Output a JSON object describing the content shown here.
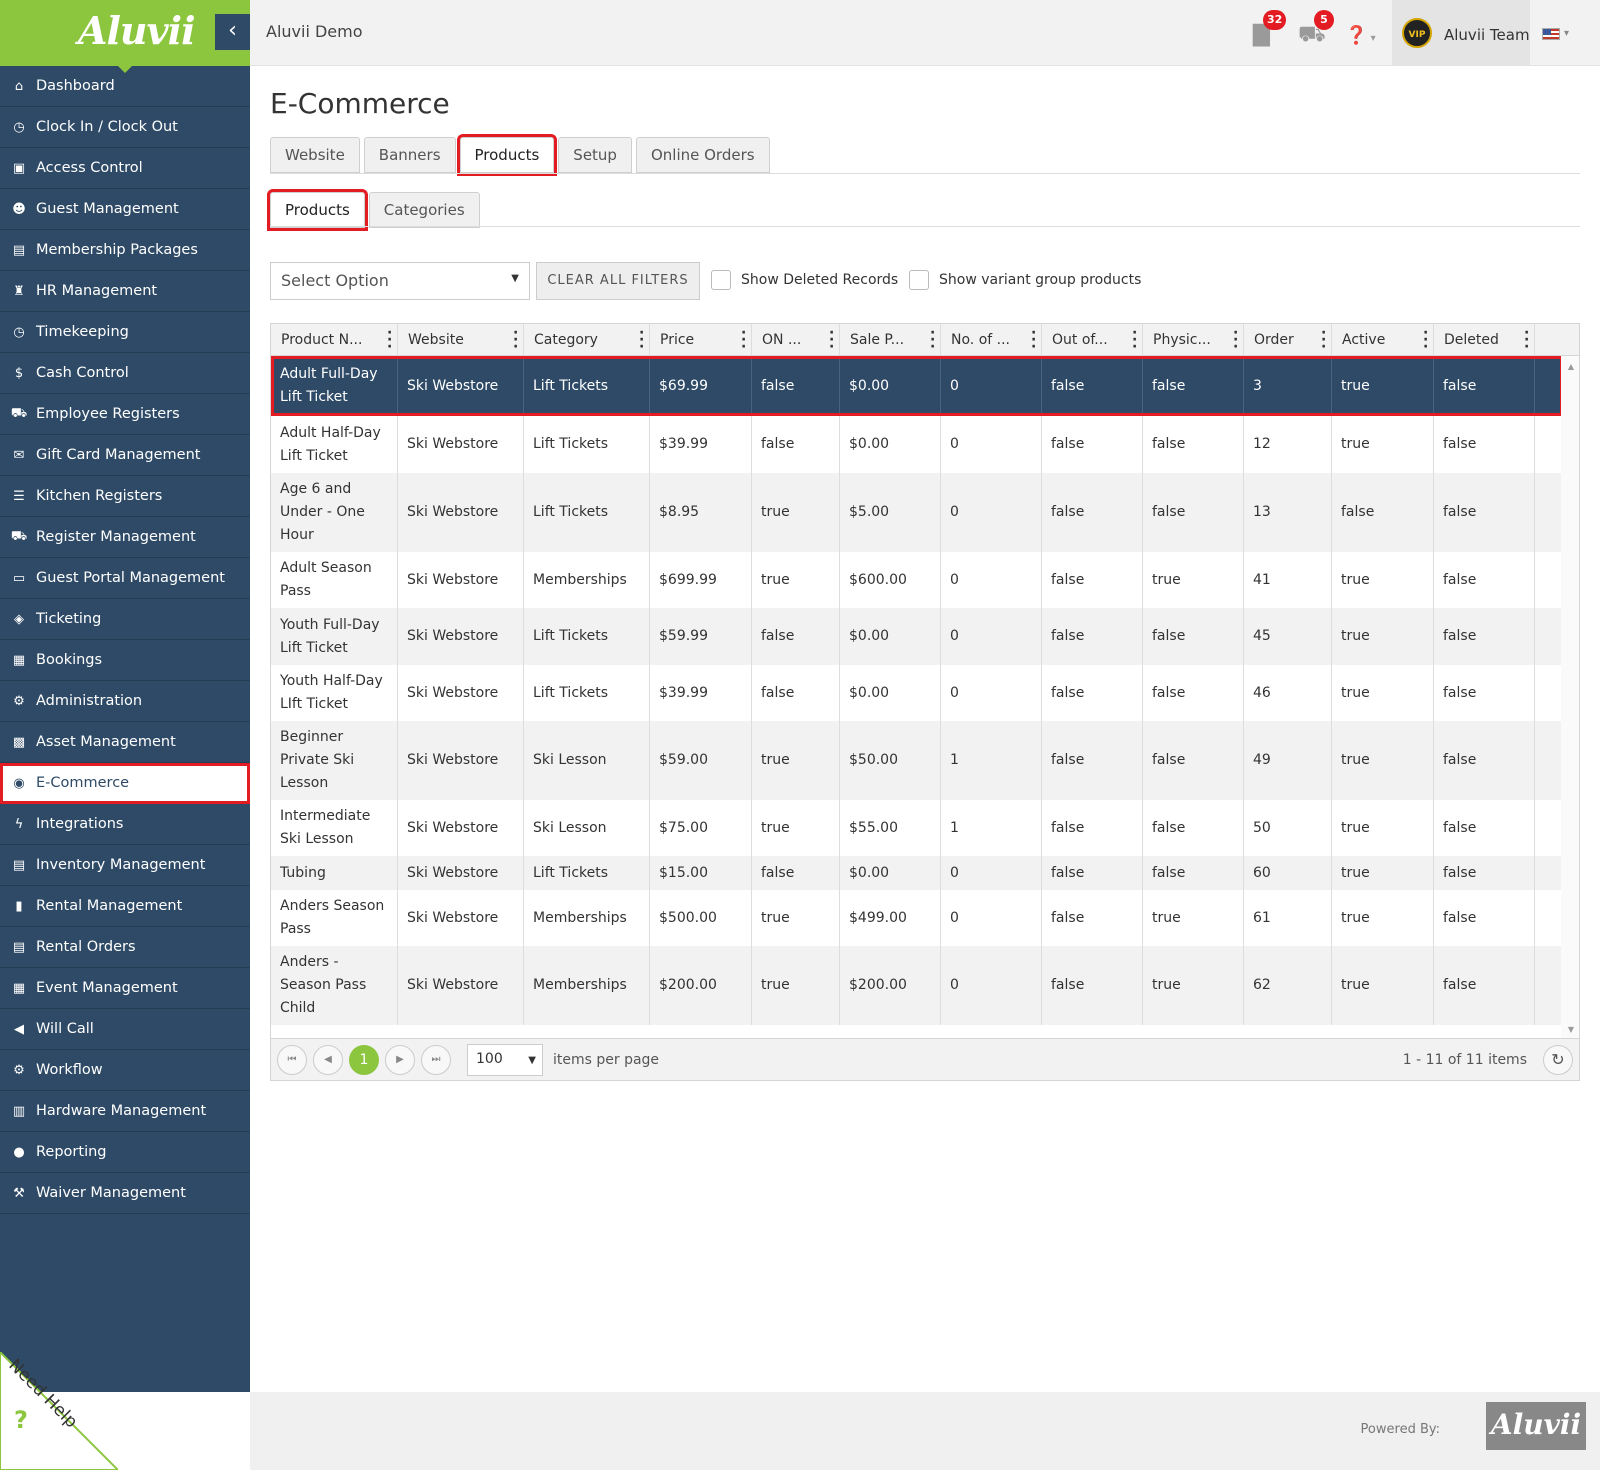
{
  "brand": {
    "logo_text": "Aluvii",
    "accent": "#8cc63f",
    "sidebar_bg": "#2e4a66",
    "highlight": "#e31b23"
  },
  "topbar": {
    "app_title": "Aluvii Demo",
    "notifications_badge": "32",
    "cart_badge": "5",
    "user_name": "Aluvii Team",
    "avatar_text": "VIP"
  },
  "sidebar": {
    "items": [
      {
        "label": "Dashboard",
        "icon": "home-icon",
        "glyph": "⌂"
      },
      {
        "label": "Clock In / Clock Out",
        "icon": "clock-icon",
        "glyph": "◷"
      },
      {
        "label": "Access Control",
        "icon": "lock-icon",
        "glyph": "▣"
      },
      {
        "label": "Guest Management",
        "icon": "users-icon",
        "glyph": "☻"
      },
      {
        "label": "Membership Packages",
        "icon": "card-icon",
        "glyph": "▤"
      },
      {
        "label": "HR Management",
        "icon": "hr-icon",
        "glyph": "♜"
      },
      {
        "label": "Timekeeping",
        "icon": "clock-icon",
        "glyph": "◷"
      },
      {
        "label": "Cash Control",
        "icon": "dollar-icon",
        "glyph": "$"
      },
      {
        "label": "Employee Registers",
        "icon": "cart-icon",
        "glyph": "⛟"
      },
      {
        "label": "Gift Card Management",
        "icon": "gift-icon",
        "glyph": "✉"
      },
      {
        "label": "Kitchen Registers",
        "icon": "list-icon",
        "glyph": "☰"
      },
      {
        "label": "Register Management",
        "icon": "cart-icon",
        "glyph": "⛟"
      },
      {
        "label": "Guest Portal Management",
        "icon": "laptop-icon",
        "glyph": "▭"
      },
      {
        "label": "Ticketing",
        "icon": "ticket-icon",
        "glyph": "◈"
      },
      {
        "label": "Bookings",
        "icon": "calendar-icon",
        "glyph": "▦"
      },
      {
        "label": "Administration",
        "icon": "cogs-icon",
        "glyph": "⚙"
      },
      {
        "label": "Asset Management",
        "icon": "cubes-icon",
        "glyph": "▩"
      },
      {
        "label": "E-Commerce",
        "icon": "globe-icon",
        "glyph": "◉"
      },
      {
        "label": "Integrations",
        "icon": "bolt-icon",
        "glyph": "ϟ"
      },
      {
        "label": "Inventory Management",
        "icon": "inventory-icon",
        "glyph": "▤"
      },
      {
        "label": "Rental Management",
        "icon": "clipboard-icon",
        "glyph": "▮"
      },
      {
        "label": "Rental Orders",
        "icon": "list-alt-icon",
        "glyph": "▤"
      },
      {
        "label": "Event Management",
        "icon": "calendar-check-icon",
        "glyph": "▦"
      },
      {
        "label": "Will Call",
        "icon": "bullhorn-icon",
        "glyph": "◀"
      },
      {
        "label": "Workflow",
        "icon": "gear-icon",
        "glyph": "⚙"
      },
      {
        "label": "Hardware Management",
        "icon": "print-icon",
        "glyph": "▥"
      },
      {
        "label": "Reporting",
        "icon": "lightbulb-icon",
        "glyph": "●"
      },
      {
        "label": "Waiver Management",
        "icon": "gavel-icon",
        "glyph": "⚒"
      }
    ],
    "active_index": 17,
    "need_help": "Need Help"
  },
  "page": {
    "title": "E-Commerce",
    "main_tabs": [
      "Website",
      "Banners",
      "Products",
      "Setup",
      "Online Orders"
    ],
    "main_active": 2,
    "sub_tabs": [
      "Products",
      "Categories"
    ],
    "sub_active": 0
  },
  "filters": {
    "select_placeholder": "Select Option",
    "clear_label": "CLEAR ALL FILTERS",
    "show_deleted": "Show Deleted Records",
    "show_variant": "Show variant group products"
  },
  "grid": {
    "columns": [
      "Product N...",
      "Website",
      "Category",
      "Price",
      "ON ...",
      "Sale P...",
      "No. of ...",
      "Out of...",
      "Physic...",
      "Order",
      "Active",
      "Deleted"
    ],
    "rows": [
      [
        "Adult Full-Day Lift Ticket",
        "Ski Webstore",
        "Lift Tickets",
        "$69.99",
        "false",
        "$0.00",
        "0",
        "false",
        "false",
        "3",
        "true",
        "false"
      ],
      [
        "Adult Half-Day Lift Ticket",
        "Ski Webstore",
        "Lift Tickets",
        "$39.99",
        "false",
        "$0.00",
        "0",
        "false",
        "false",
        "12",
        "true",
        "false"
      ],
      [
        "Age 6 and Under - One Hour",
        "Ski Webstore",
        "Lift Tickets",
        "$8.95",
        "true",
        "$5.00",
        "0",
        "false",
        "false",
        "13",
        "false",
        "false"
      ],
      [
        "Adult Season Pass",
        "Ski Webstore",
        "Memberships",
        "$699.99",
        "true",
        "$600.00",
        "0",
        "false",
        "true",
        "41",
        "true",
        "false"
      ],
      [
        "Youth Full-Day Lift Ticket",
        "Ski Webstore",
        "Lift Tickets",
        "$59.99",
        "false",
        "$0.00",
        "0",
        "false",
        "false",
        "45",
        "true",
        "false"
      ],
      [
        "Youth Half-Day LIft Ticket",
        "Ski Webstore",
        "Lift Tickets",
        "$39.99",
        "false",
        "$0.00",
        "0",
        "false",
        "false",
        "46",
        "true",
        "false"
      ],
      [
        "Beginner Private Ski Lesson",
        "Ski Webstore",
        "Ski Lesson",
        "$59.00",
        "true",
        "$50.00",
        "1",
        "false",
        "false",
        "49",
        "true",
        "false"
      ],
      [
        "Intermediate Ski Lesson",
        "Ski Webstore",
        "Ski Lesson",
        "$75.00",
        "true",
        "$55.00",
        "1",
        "false",
        "false",
        "50",
        "true",
        "false"
      ],
      [
        "Tubing",
        "Ski Webstore",
        "Lift Tickets",
        "$15.00",
        "false",
        "$0.00",
        "0",
        "false",
        "false",
        "60",
        "true",
        "false"
      ],
      [
        "Anders Season Pass",
        "Ski Webstore",
        "Memberships",
        "$500.00",
        "true",
        "$499.00",
        "0",
        "false",
        "true",
        "61",
        "true",
        "false"
      ],
      [
        "Anders - Season Pass Child",
        "Ski Webstore",
        "Memberships",
        "$200.00",
        "true",
        "$200.00",
        "0",
        "false",
        "true",
        "62",
        "true",
        "false"
      ]
    ],
    "selected_row": 0
  },
  "pager": {
    "current_page": "1",
    "per_page": "100",
    "per_page_label": "items per page",
    "summary": "1 - 11 of 11 items"
  },
  "footer": {
    "powered_by": "Powered By:",
    "logo_text": "Aluvii"
  }
}
